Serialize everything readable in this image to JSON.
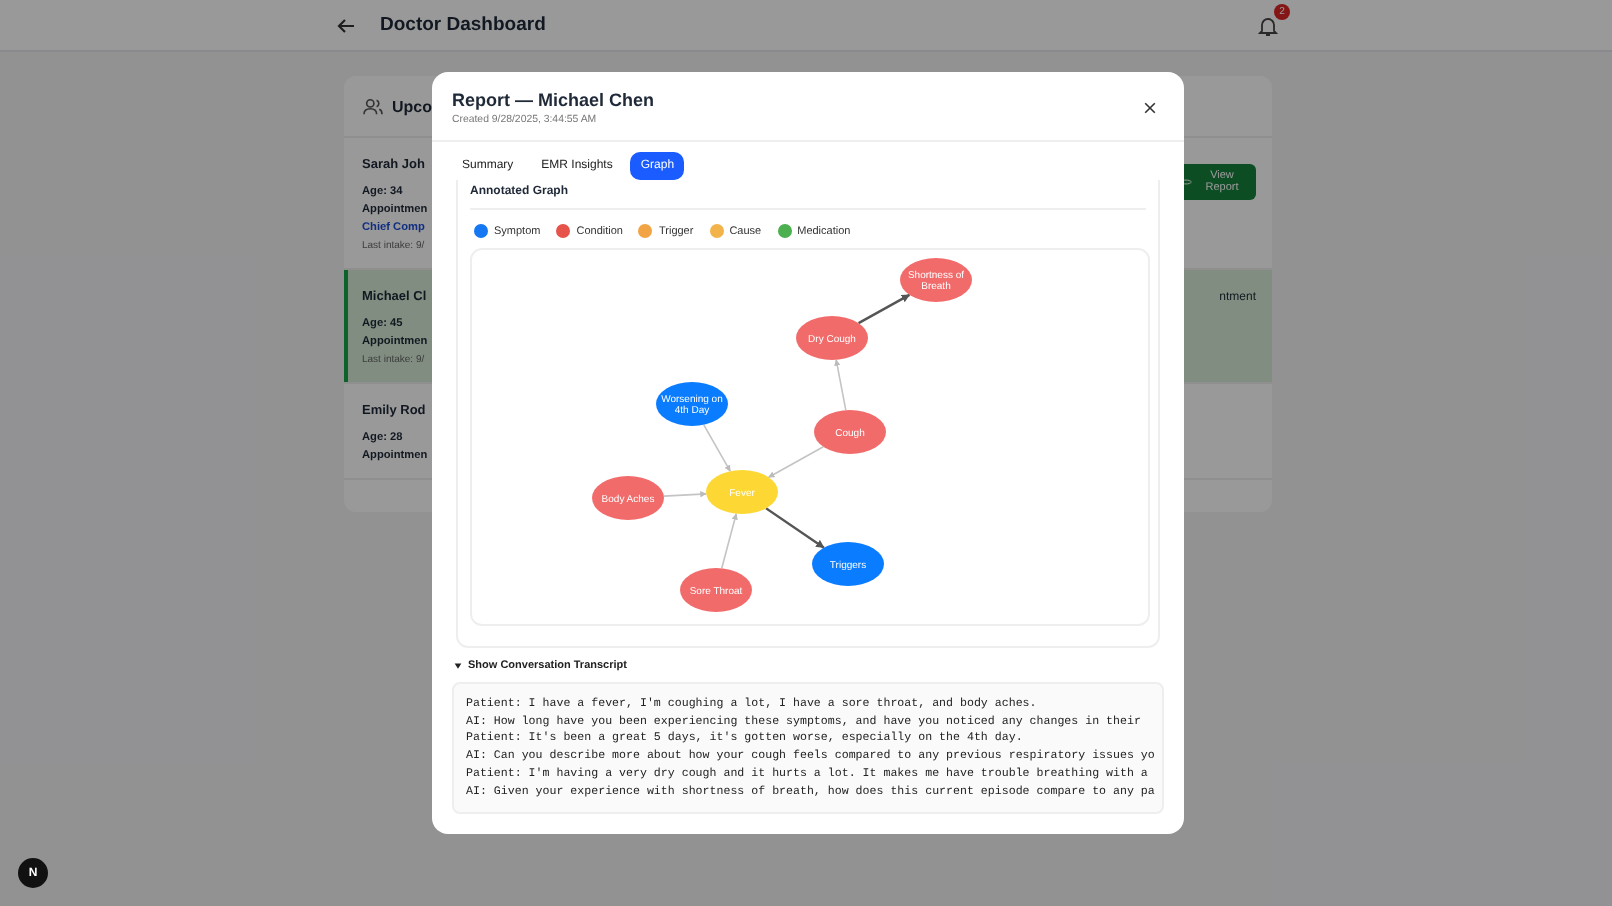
{
  "header": {
    "title": "Doctor Dashboard",
    "notification_count": "2"
  },
  "appointments": {
    "title": "Upco",
    "patients": [
      {
        "name": "Sarah Joh",
        "selected": false,
        "fields": [
          "Age: 34",
          "Appointmen"
        ],
        "chief": "Chief Comp",
        "last_intake": "Last intake: 9/"
      },
      {
        "name": "Michael Cl",
        "selected": true,
        "fields": [
          "Age: 45",
          "Appointmen"
        ],
        "last_intake": "Last intake: 9/"
      },
      {
        "name": "Emily Rod",
        "selected": false,
        "fields": [
          "Age: 28",
          "Appointmen"
        ]
      }
    ],
    "view_report_button": "View Report",
    "side_text": "ntment"
  },
  "modal": {
    "title": "Report — Michael Chen",
    "subtitle": "Created 9/28/2025, 3:44:55 AM",
    "tabs": [
      {
        "label": "Summary",
        "selected": false
      },
      {
        "label": "EMR Insights",
        "selected": false
      },
      {
        "label": "Graph",
        "selected": true
      }
    ],
    "graph": {
      "title": "Annotated Graph",
      "legend": [
        {
          "label": "Symptom",
          "color": "#1677f2"
        },
        {
          "label": "Condition",
          "color": "#e5534b"
        },
        {
          "label": "Trigger",
          "color": "#f2a444"
        },
        {
          "label": "Cause",
          "color": "#f2b44a"
        },
        {
          "label": "Medication",
          "color": "#4caf50"
        }
      ],
      "nodes": [
        {
          "label": "Shortness of Breath",
          "color": "#f26b6b"
        },
        {
          "label": "Dry Cough",
          "color": "#f26b6b"
        },
        {
          "label": "Worsening on 4th Day",
          "color": "#0a7cff"
        },
        {
          "label": "Cough",
          "color": "#f26b6b"
        },
        {
          "label": "Fever",
          "color": "#fdd835"
        },
        {
          "label": "Body Aches",
          "color": "#f26b6b"
        },
        {
          "label": "Sore Throat",
          "color": "#f26b6b"
        },
        {
          "label": "Triggers",
          "color": "#0a7cff"
        }
      ]
    },
    "transcript": {
      "label": "Show Conversation Transcript",
      "expanded": true,
      "lines": [
        "Patient: I have a fever, I'm coughing a lot, I have a sore throat, and body aches.",
        "AI: How long have you been experiencing these symptoms, and have you noticed any changes in their",
        "Patient: It's been a great 5 days, it's gotten worse, especially on the 4th day.",
        "AI: Can you describe more about how your cough feels compared to any previous respiratory issues yo",
        "Patient: I'm having a very dry cough and it hurts a lot. It makes me have trouble breathing with a",
        "AI: Given your experience with shortness of breath, how does this current episode compare to any pa"
      ]
    }
  },
  "dev_badge": "N"
}
